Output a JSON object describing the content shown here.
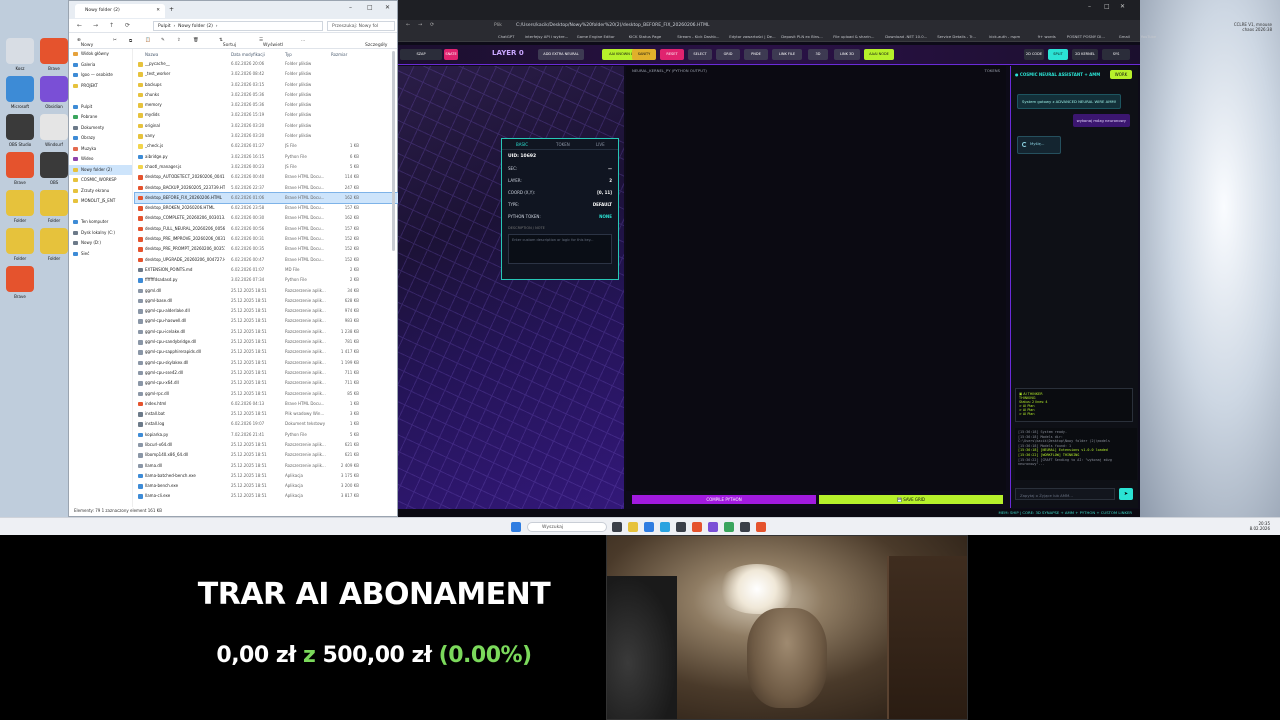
{
  "explorer": {
    "tab_title": "Nowy folder (2)",
    "path": [
      "Pulpit",
      "Nowy folder (2)"
    ],
    "search_placeholder": "Przeszukaj: Nowy fol",
    "toolbar": {
      "new": "Nowy",
      "sort": "Sortuj",
      "view": "Wyświetl",
      "more": "...",
      "details": "Szczegóły"
    },
    "nav_items": [
      {
        "label": "Widok główny",
        "color": "#e6a23c"
      },
      {
        "label": "Galeria",
        "color": "#3d8bd6"
      },
      {
        "label": "lgoo — osobiste",
        "color": "#3d8bd6"
      },
      {
        "label": "PROJEKT",
        "color": "#e6c23c"
      },
      {
        "label": "",
        "color": "#ffffff"
      },
      {
        "label": "Pulpit",
        "color": "#3d8bd6"
      },
      {
        "label": "Pobrane",
        "color": "#3aa55d"
      },
      {
        "label": "Dokumenty",
        "color": "#6c7a89"
      },
      {
        "label": "Obrazy",
        "color": "#3d8bd6"
      },
      {
        "label": "Muzyka",
        "color": "#e36a4f"
      },
      {
        "label": "Wideo",
        "color": "#8e44ad"
      },
      {
        "label": "Nowy folder (2)",
        "color": "#e6c23c"
      },
      {
        "label": "COSMIC_WORKSP",
        "color": "#e6c23c"
      },
      {
        "label": "Zrzuty ekranu",
        "color": "#e6c23c"
      },
      {
        "label": "MONOLIT_JS_ENT",
        "color": "#e6c23c"
      },
      {
        "label": "",
        "color": "#ffffff"
      },
      {
        "label": "Ten komputer",
        "color": "#3d8bd6"
      },
      {
        "label": "Dysk lokalny (C:)",
        "color": "#6c7a89"
      },
      {
        "label": "Nowy (D:)",
        "color": "#6c7a89"
      },
      {
        "label": "Sieć",
        "color": "#3d8bd6"
      }
    ],
    "columns": {
      "name": "Nazwa",
      "date": "Data modyfikacji",
      "type": "Typ",
      "size": "Rozmiar"
    },
    "files": [
      {
        "name": "__pycache__",
        "date": "6.02.2026 20:06",
        "type": "Folder plików",
        "size": "",
        "color": "#e6c23c"
      },
      {
        "name": "_test_worker",
        "date": "3.02.2026 08:42",
        "type": "Folder plików",
        "size": "",
        "color": "#e6c23c"
      },
      {
        "name": "backups",
        "date": "3.02.2026 03:15",
        "type": "Folder plików",
        "size": "",
        "color": "#e6c23c"
      },
      {
        "name": "chunks",
        "date": "3.02.2026 05:36",
        "type": "Folder plików",
        "size": "",
        "color": "#e6c23c"
      },
      {
        "name": "memory",
        "date": "3.02.2026 05:36",
        "type": "Folder plików",
        "size": "",
        "color": "#e6c23c"
      },
      {
        "name": "mydids",
        "date": "3.02.2026 15:19",
        "type": "Folder plików",
        "size": "",
        "color": "#e6c23c"
      },
      {
        "name": "original",
        "date": "3.02.2026 03:20",
        "type": "Folder plików",
        "size": "",
        "color": "#e6c23c"
      },
      {
        "name": "vany",
        "date": "3.02.2026 03:20",
        "type": "Folder plików",
        "size": "",
        "color": "#e6c23c"
      },
      {
        "name": "_check.js",
        "date": "6.02.2026 01:27",
        "type": "JS File",
        "size": "1 KB",
        "color": "#f2d44c"
      },
      {
        "name": "aibridge.py",
        "date": "3.02.2026 16:15",
        "type": "Python File",
        "size": "6 KB",
        "color": "#3d8bd6"
      },
      {
        "name": "chaotl_manager.js",
        "date": "3.02.2026 00:23",
        "type": "JS File",
        "size": "5 KB",
        "color": "#f2d44c"
      },
      {
        "name": "desktop_AUTODETECT_20260206_00417...",
        "date": "6.02.2026 00:40",
        "type": "Brave HTML Docu...",
        "size": "114 KB",
        "color": "#e5532d"
      },
      {
        "name": "desktop_BACKUP_20260205_223739.HTML",
        "date": "5.02.2026 22:37",
        "type": "Brave HTML Docu...",
        "size": "247 KB",
        "color": "#e5532d"
      },
      {
        "name": "desktop_BEFORE_FIX_20260206.HTML",
        "date": "6.02.2026 01:06",
        "type": "Brave HTML Docu...",
        "size": "162 KB",
        "color": "#e5532d"
      },
      {
        "name": "desktop_BROKEN_20260206.HTML",
        "date": "6.02.2026 23:58",
        "type": "Brave HTML Docu...",
        "size": "157 KB",
        "color": "#e5532d"
      },
      {
        "name": "desktop_COMPLETE_20260206_003013.H...",
        "date": "6.02.2026 00:30",
        "type": "Brave HTML Docu...",
        "size": "162 KB",
        "color": "#e5532d"
      },
      {
        "name": "desktop_FULL_NEURAL_20260206_005649...",
        "date": "6.02.2026 00:56",
        "type": "Brave HTML Docu...",
        "size": "157 KB",
        "color": "#e5532d"
      },
      {
        "name": "desktop_PRE_IMPROVE_20260206_003109...",
        "date": "6.02.2026 00:31",
        "type": "Brave HTML Docu...",
        "size": "152 KB",
        "color": "#e5532d"
      },
      {
        "name": "desktop_PRE_PROMPT_20260206_003517...",
        "date": "6.02.2026 00:35",
        "type": "Brave HTML Docu...",
        "size": "152 KB",
        "color": "#e5532d"
      },
      {
        "name": "desktop_UPGRADE_20260206_004727.HT...",
        "date": "6.02.2026 00:47",
        "type": "Brave HTML Docu...",
        "size": "152 KB",
        "color": "#e5532d"
      },
      {
        "name": "EXTENSION_POINTS.md",
        "date": "6.02.2026 01:07",
        "type": "MD File",
        "size": "2 KB",
        "color": "#6c7a89"
      },
      {
        "name": "fffffffdsadasd.py",
        "date": "3.02.2026 07:34",
        "type": "Python File",
        "size": "2 KB",
        "color": "#3d8bd6"
      },
      {
        "name": "ggml.dll",
        "date": "25.12.2025 18:51",
        "type": "Rozszerzenie aplik...",
        "size": "34 KB",
        "color": "#8a96a6"
      },
      {
        "name": "ggml-base.dll",
        "date": "25.12.2025 18:51",
        "type": "Rozszerzenie aplik...",
        "size": "628 KB",
        "color": "#8a96a6"
      },
      {
        "name": "ggml-cpu-alderlake.dll",
        "date": "25.12.2025 18:51",
        "type": "Rozszerzenie aplik...",
        "size": "974 KB",
        "color": "#8a96a6"
      },
      {
        "name": "ggml-cpu-haswell.dll",
        "date": "25.12.2025 18:51",
        "type": "Rozszerzenie aplik...",
        "size": "983 KB",
        "color": "#8a96a6"
      },
      {
        "name": "ggml-cpu-icelake.dll",
        "date": "25.12.2025 18:51",
        "type": "Rozszerzenie aplik...",
        "size": "1 238 KB",
        "color": "#8a96a6"
      },
      {
        "name": "ggml-cpu-sandybridge.dll",
        "date": "25.12.2025 18:51",
        "type": "Rozszerzenie aplik...",
        "size": "781 KB",
        "color": "#8a96a6"
      },
      {
        "name": "ggml-cpu-sapphirerapids.dll",
        "date": "25.12.2025 18:51",
        "type": "Rozszerzenie aplik...",
        "size": "1 417 KB",
        "color": "#8a96a6"
      },
      {
        "name": "ggml-cpu-skylakex.dll",
        "date": "25.12.2025 18:51",
        "type": "Rozszerzenie aplik...",
        "size": "1 199 KB",
        "color": "#8a96a6"
      },
      {
        "name": "ggml-cpu-sse42.dll",
        "date": "25.12.2025 18:51",
        "type": "Rozszerzenie aplik...",
        "size": "711 KB",
        "color": "#8a96a6"
      },
      {
        "name": "ggml-cpu-x64.dll",
        "date": "25.12.2025 18:51",
        "type": "Rozszerzenie aplik...",
        "size": "711 KB",
        "color": "#8a96a6"
      },
      {
        "name": "ggml-rpc.dll",
        "date": "25.12.2025 18:51",
        "type": "Rozszerzenie aplik...",
        "size": "85 KB",
        "color": "#8a96a6"
      },
      {
        "name": "index.html",
        "date": "6.02.2026 04:13",
        "type": "Brave HTML Docu...",
        "size": "1 KB",
        "color": "#e5532d"
      },
      {
        "name": "install.bat",
        "date": "25.12.2025 18:51",
        "type": "Plik wsadowy Win...",
        "size": "3 KB",
        "color": "#6c7a89"
      },
      {
        "name": "install.log",
        "date": "6.02.2026 19:07",
        "type": "Dokument tekstowy",
        "size": "1 KB",
        "color": "#6c7a89"
      },
      {
        "name": "kopiarka.py",
        "date": "7.02.2026 21:41",
        "type": "Python File",
        "size": "5 KB",
        "color": "#3d8bd6"
      },
      {
        "name": "libcurl-x64.dll",
        "date": "25.12.2025 18:51",
        "type": "Rozszerzenie aplik...",
        "size": "621 KB",
        "color": "#8a96a6"
      },
      {
        "name": "libomp140.x86_64.dll",
        "date": "25.12.2025 18:51",
        "type": "Rozszerzenie aplik...",
        "size": "621 KB",
        "color": "#8a96a6"
      },
      {
        "name": "llama.dll",
        "date": "25.12.2025 18:51",
        "type": "Rozszerzenie aplik...",
        "size": "2 409 KB",
        "color": "#8a96a6"
      },
      {
        "name": "llama-batched-bench.exe",
        "date": "25.12.2025 18:51",
        "type": "Aplikacja",
        "size": "3 175 KB",
        "color": "#3d8bd6"
      },
      {
        "name": "llama-bench.exe",
        "date": "25.12.2025 18:51",
        "type": "Aplikacja",
        "size": "3 200 KB",
        "color": "#3d8bd6"
      },
      {
        "name": "llama-cli.exe",
        "date": "25.12.2025 18:51",
        "type": "Aplikacja",
        "size": "3 817 KB",
        "color": "#3d8bd6"
      }
    ],
    "status": "Elementy: 79    1 zaznaczony element  161 KB"
  },
  "desktop_icons": [
    {
      "label": "Kosz",
      "color": "#d8dde4"
    },
    {
      "label": "Brave",
      "color": "#e5532d"
    },
    {
      "label": "Microsoft",
      "color": "#3d8bd6"
    },
    {
      "label": "Obsidian",
      "color": "#7a4fd6"
    },
    {
      "label": "OBS Studio",
      "color": "#3a3a3a"
    },
    {
      "label": "Windsurf",
      "color": "#e5e5e5"
    },
    {
      "label": "Brave",
      "color": "#e5532d"
    },
    {
      "label": "OBS",
      "color": "#3a3a3a"
    },
    {
      "label": "Folder",
      "color": "#e6c23c"
    },
    {
      "label": "Folder",
      "color": "#e6c23c"
    },
    {
      "label": "Folder",
      "color": "#e6c23c"
    },
    {
      "label": "Folder",
      "color": "#e6c23c"
    },
    {
      "label": "Brave",
      "color": "#e5532d"
    }
  ],
  "browser": {
    "url": "C:/Users/kacik/Desktop/Nowy%20folder%20(2)/desktop_BEFORE_FIX_20260206.HTML",
    "url_prefix": "Plik",
    "bookmarks": [
      "ChatGPT",
      "interfejsy API i wykre...",
      "Game Engine Editor",
      "KICK Status Page",
      "Stream - Kick Dashb...",
      "Edytor zawartości | De...",
      "Deposit PLN ex Bins...",
      "File upload & sharin...",
      "Download .NET 10.0...",
      "Service Details - Tr...",
      "kick-auth - rspm",
      "9+ words",
      "POSNET POSNY DI...",
      "Gmail",
      "YouTube"
    ],
    "app": {
      "layer_label": "LAYER 0",
      "buttons": [
        {
          "label": "SZAP",
          "color": "#2b2d3a"
        },
        {
          "label": "SNATE",
          "color": "#e0236f"
        },
        {
          "label": "ADD EXTRA NEURAL",
          "color": "#3d3a52"
        },
        {
          "label": "AAI KNOWN LINK",
          "color": "#b6f02b"
        },
        {
          "label": "SANITY",
          "color": "#e0b02b"
        },
        {
          "label": "RESET",
          "color": "#e0236f"
        },
        {
          "label": "SELECT",
          "color": "#3d3a52"
        },
        {
          "label": "GRID",
          "color": "#3d3a52"
        },
        {
          "label": "PNDE",
          "color": "#3d3a52"
        },
        {
          "label": "LINK FILE",
          "color": "#3d3a52"
        },
        {
          "label": "3D",
          "color": "#3d3a52"
        },
        {
          "label": "LINK 3D",
          "color": "#3d3a52"
        },
        {
          "label": "AAAI NODE",
          "color": "#b6f02b"
        },
        {
          "label": "2D CODE",
          "color": "#2b2d3a"
        },
        {
          "label": "SPLIT",
          "color": "#2be3d4"
        },
        {
          "label": "2D KERNEL",
          "color": "#2b2d3a"
        },
        {
          "label": "SYS",
          "color": "#2b2d3a"
        }
      ],
      "props": {
        "tabs": [
          "BASIC",
          "TOKEN",
          "LIVE"
        ],
        "uid_label": "UID: 10692",
        "rows": [
          {
            "key": "SEC:",
            "value": "—"
          },
          {
            "key": "LAYER:",
            "value": "2"
          },
          {
            "key": "COORD (X,Y):",
            "value": "[0, 11]"
          },
          {
            "key": "TYPE:",
            "value": "DEFAULT"
          },
          {
            "key": "PYTHON TOKEN:",
            "value": "NONE"
          }
        ],
        "note_label": "DESCRIPTION / NOTE",
        "note_placeholder": "Enter custom description or logic for this key..."
      },
      "nodes_head": "NEURAL_KERNEL_PY (PYTHON OUTPUT)",
      "nodes_tokens": "TOKENS",
      "compile_label": "COMPILE PYTHON",
      "save_label": "💾 SAVE GRID",
      "status_line": "MEM: SHIP | CORE: 3D SYNAPSE + AMM + PYTHON + CUSTOM LINKER",
      "chat": {
        "title": "● COSMIC NEURAL ASSISTANT + AMM",
        "work_label": "WORK",
        "system_msg": "System gotowy z ADVANCED NEURAL WIRE AMM!",
        "user_msg": "wykonaj mózg neuronowy",
        "thinking": "Myślę...",
        "mini_term": [
          "▣ AI THINKER",
          "THINKING",
          "Status: 2 lines: 4",
          "> AI Plan",
          "> AI Plan",
          "> AI Plan"
        ],
        "log": [
          {
            "text": "[15:36:18] System ready.",
            "hl": false
          },
          {
            "text": "[15:36:18] Models dir:",
            "hl": false
          },
          {
            "text": "C:\\Users\\kacik\\Desktop\\Nowy folder (2)\\models",
            "hl": false
          },
          {
            "text": "[15:36:18] Models found: 1",
            "hl": false
          },
          {
            "text": "[15:36:18] [NEURAL] Extensions v1.0.0 loaded",
            "hl": true
          },
          {
            "text": "[15:36:22] [WORKFLOW] THINKING",
            "hl": true
          },
          {
            "text": "[15:36:22] [CRAFT Sending to AI: \"wykonaj mózg",
            "hl": false
          },
          {
            "text": "neuronowy\"...",
            "hl": false
          }
        ],
        "input_placeholder": "Zapytaj o Żyjące lub AMM...",
        "send_label": "➤"
      }
    }
  },
  "taskbar": {
    "search_placeholder": "Wyszukaj",
    "clock_time": "20:35",
    "clock_date": "8.02.2026"
  },
  "overlay": {
    "title": "TRAR AI ABONAMENT",
    "amount_current": "0,00 zł",
    "amount_sep": "z",
    "amount_target": "500,00 zł",
    "amount_percent": "(0.00%)"
  },
  "corner": {
    "text1": "CCLRE V1, mnouse",
    "text2": "chaos 2026:38"
  }
}
